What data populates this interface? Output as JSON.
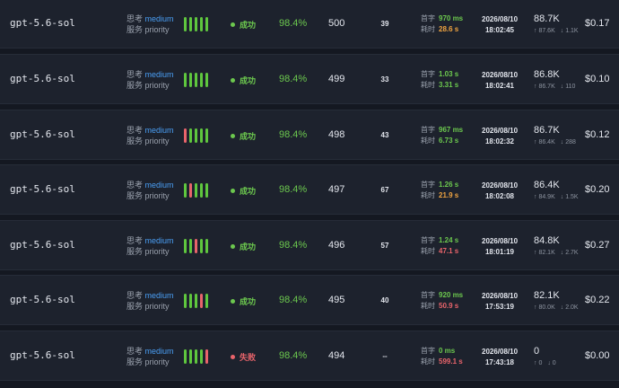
{
  "labels": {
    "think": "思考",
    "service": "服务",
    "first_token": "首字",
    "duration": "耗时"
  },
  "colors": {
    "green": "#6cc84e",
    "red": "#e9646b",
    "orange": "#f0a441",
    "blue": "#4a9ff5",
    "bar_green": "#5fc73e",
    "bar_red": "#e9646b"
  },
  "rows": [
    {
      "model": "gpt-5.6-sol",
      "think": "medium",
      "service": "priority",
      "bars": [
        "g",
        "g",
        "g",
        "g",
        "g"
      ],
      "status": "成功",
      "status_kind": "success",
      "rate": "98.4%",
      "id": "500",
      "count": "39",
      "first_token": "970 ms",
      "first_color": "green",
      "duration": "28.6 s",
      "duration_color": "orange",
      "date": "2026/08/10",
      "time": "18:02:45",
      "tokens_total": "88.7K",
      "tokens_in": "↑ 87.6K",
      "tokens_out": "↓ 1.1K",
      "cost": "$0.17"
    },
    {
      "model": "gpt-5.6-sol",
      "think": "medium",
      "service": "priority",
      "bars": [
        "g",
        "g",
        "g",
        "g",
        "g"
      ],
      "status": "成功",
      "status_kind": "success",
      "rate": "98.4%",
      "id": "499",
      "count": "33",
      "first_token": "1.03 s",
      "first_color": "green",
      "duration": "3.31 s",
      "duration_color": "green",
      "date": "2026/08/10",
      "time": "18:02:41",
      "tokens_total": "86.8K",
      "tokens_in": "↑ 86.7K",
      "tokens_out": "↓ 110",
      "cost": "$0.10"
    },
    {
      "model": "gpt-5.6-sol",
      "think": "medium",
      "service": "priority",
      "bars": [
        "r",
        "g",
        "g",
        "g",
        "g"
      ],
      "status": "成功",
      "status_kind": "success",
      "rate": "98.4%",
      "id": "498",
      "count": "43",
      "first_token": "967 ms",
      "first_color": "green",
      "duration": "6.73 s",
      "duration_color": "green",
      "date": "2026/08/10",
      "time": "18:02:32",
      "tokens_total": "86.7K",
      "tokens_in": "↑ 86.4K",
      "tokens_out": "↓ 288",
      "cost": "$0.12"
    },
    {
      "model": "gpt-5.6-sol",
      "think": "medium",
      "service": "priority",
      "bars": [
        "g",
        "r",
        "g",
        "g",
        "g"
      ],
      "status": "成功",
      "status_kind": "success",
      "rate": "98.4%",
      "id": "497",
      "count": "67",
      "first_token": "1.26 s",
      "first_color": "green",
      "duration": "21.9 s",
      "duration_color": "orange",
      "date": "2026/08/10",
      "time": "18:02:08",
      "tokens_total": "86.4K",
      "tokens_in": "↑ 84.9K",
      "tokens_out": "↓ 1.5K",
      "cost": "$0.20"
    },
    {
      "model": "gpt-5.6-sol",
      "think": "medium",
      "service": "priority",
      "bars": [
        "g",
        "g",
        "r",
        "g",
        "g"
      ],
      "status": "成功",
      "status_kind": "success",
      "rate": "98.4%",
      "id": "496",
      "count": "57",
      "first_token": "1.24 s",
      "first_color": "green",
      "duration": "47.1 s",
      "duration_color": "red",
      "date": "2026/08/10",
      "time": "18:01:19",
      "tokens_total": "84.8K",
      "tokens_in": "↑ 82.1K",
      "tokens_out": "↓ 2.7K",
      "cost": "$0.27"
    },
    {
      "model": "gpt-5.6-sol",
      "think": "medium",
      "service": "priority",
      "bars": [
        "g",
        "g",
        "g",
        "r",
        "g"
      ],
      "status": "成功",
      "status_kind": "success",
      "rate": "98.4%",
      "id": "495",
      "count": "40",
      "first_token": "920 ms",
      "first_color": "green",
      "duration": "50.9 s",
      "duration_color": "red",
      "date": "2026/08/10",
      "time": "17:53:19",
      "tokens_total": "82.1K",
      "tokens_in": "↑ 80.0K",
      "tokens_out": "↓ 2.0K",
      "cost": "$0.22"
    },
    {
      "model": "gpt-5.6-sol",
      "think": "medium",
      "service": "priority",
      "bars": [
        "g",
        "g",
        "g",
        "g",
        "r"
      ],
      "status": "失败",
      "status_kind": "fail",
      "rate": "98.4%",
      "id": "494",
      "count": "--",
      "first_token": "0 ms",
      "first_color": "green",
      "duration": "599.1 s",
      "duration_color": "red",
      "date": "2026/08/10",
      "time": "17:43:18",
      "tokens_total": "0",
      "tokens_in": "↑ 0",
      "tokens_out": "↓ 0",
      "cost": "$0.00"
    }
  ]
}
